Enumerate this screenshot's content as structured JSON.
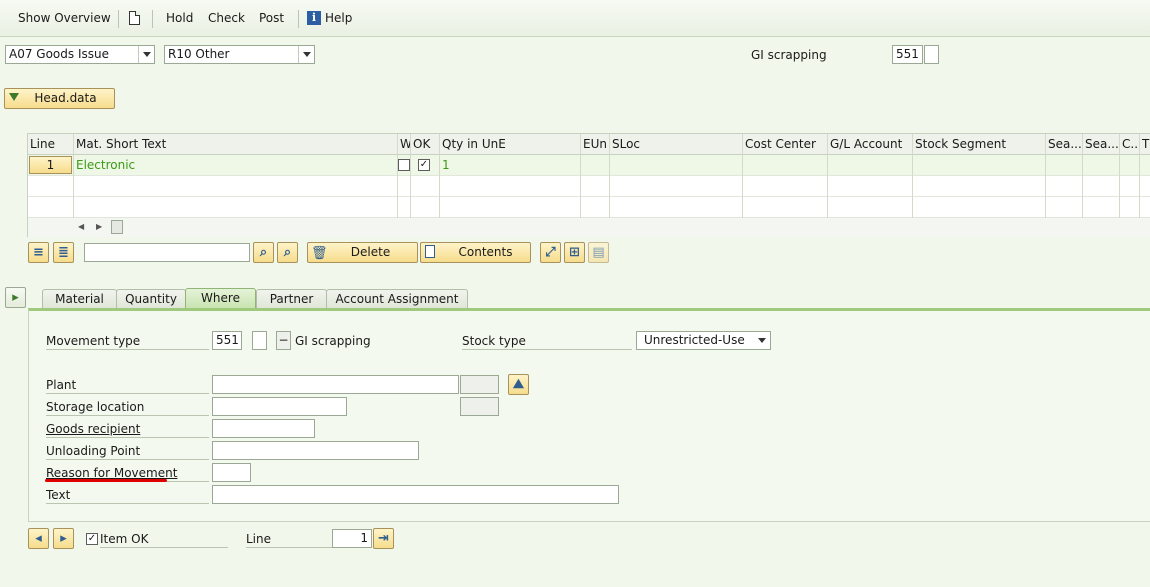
{
  "toolbar": {
    "show_overview": "Show Overview",
    "hold": "Hold",
    "check": "Check",
    "post": "Post",
    "help": "Help"
  },
  "header": {
    "action_value": "A07 Goods Issue",
    "reference_value": "R10 Other",
    "gi_label": "GI scrapping",
    "gi_movement_type": "551",
    "head_data_button": "Head.data"
  },
  "items_table": {
    "columns": [
      "Line",
      "Mat. Short Text",
      "W",
      "OK",
      "Qty in UnE",
      "EUn",
      "SLoc",
      "Cost Center",
      "G/L Account",
      "Stock Segment",
      "Sea...",
      "Sea...",
      "C..",
      "T"
    ],
    "rows": [
      {
        "line": "1",
        "mat_short_text": "Electronic",
        "w_checked": false,
        "ok_checked": true,
        "qty": "1"
      }
    ]
  },
  "table_toolbar": {
    "search_value": "",
    "delete_label": "Delete",
    "contents_label": "Contents"
  },
  "tabs": [
    "Material",
    "Quantity",
    "Where",
    "Partner",
    "Account Assignment"
  ],
  "active_tab": "Where",
  "where_tab": {
    "movement_type_label": "Movement type",
    "movement_type_value": "551",
    "movement_type_indicator": "",
    "movement_type_sign": "−",
    "movement_type_text": "GI scrapping",
    "stock_type_label": "Stock type",
    "stock_type_value": "Unrestricted-Use",
    "plant_label": "Plant",
    "plant_value": "",
    "storage_location_label": "Storage location",
    "storage_location_value": "",
    "goods_recipient_label": "Goods recipient",
    "goods_recipient_value": "",
    "unloading_point_label": "Unloading Point",
    "unloading_point_value": "",
    "reason_label": "Reason for Movement",
    "reason_value": "",
    "text_label": "Text",
    "text_value": ""
  },
  "footer": {
    "item_ok_label": "Item OK",
    "item_ok_checked": true,
    "line_label": "Line",
    "line_value": "1"
  },
  "colors": {
    "accent_green": "#3b9b17",
    "highlight_red": "#e10000",
    "button_yellow": "#f6dc8c"
  }
}
